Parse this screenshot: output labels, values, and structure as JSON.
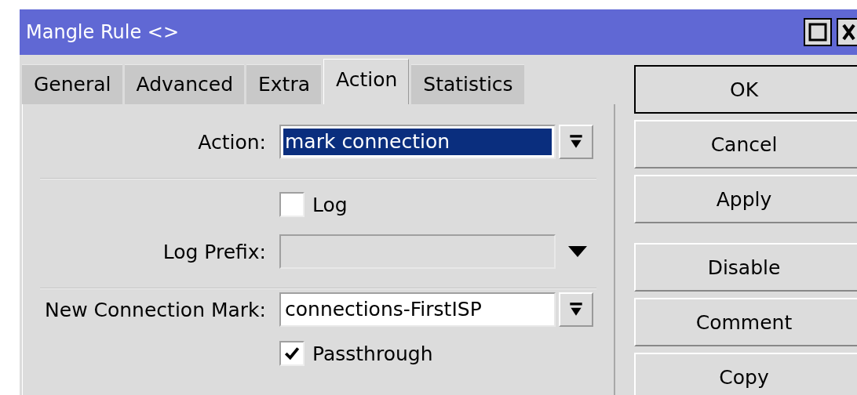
{
  "window": {
    "title": "Mangle Rule <>"
  },
  "tabs": [
    {
      "label": "General",
      "selected": false
    },
    {
      "label": "Advanced",
      "selected": false
    },
    {
      "label": "Extra",
      "selected": false
    },
    {
      "label": "Action",
      "selected": true
    },
    {
      "label": "Statistics",
      "selected": false
    }
  ],
  "fields": [
    {
      "kind": "select",
      "label": "Action:",
      "value": "mark connection",
      "text_selected": true,
      "disabled": false
    },
    {
      "kind": "separator"
    },
    {
      "kind": "checkbox",
      "label": "Log",
      "checked": false
    },
    {
      "kind": "combo",
      "label": "Log Prefix:",
      "disabled": true
    },
    {
      "kind": "separator"
    },
    {
      "kind": "select",
      "label": "New Connection Mark:",
      "value": "connections-FirstISP",
      "disabled": false
    },
    {
      "kind": "checkbox",
      "label": "Passthrough",
      "checked": true
    }
  ],
  "button_groups": [
    {
      "buttons": [
        {
          "label": "OK",
          "default": true
        },
        {
          "label": "Cancel",
          "default": false
        },
        {
          "label": "Apply",
          "default": false
        }
      ]
    },
    {
      "buttons": [
        {
          "label": "Disable",
          "default": false
        },
        {
          "label": "Comment",
          "default": false
        },
        {
          "label": "Copy",
          "default": false
        }
      ]
    }
  ]
}
